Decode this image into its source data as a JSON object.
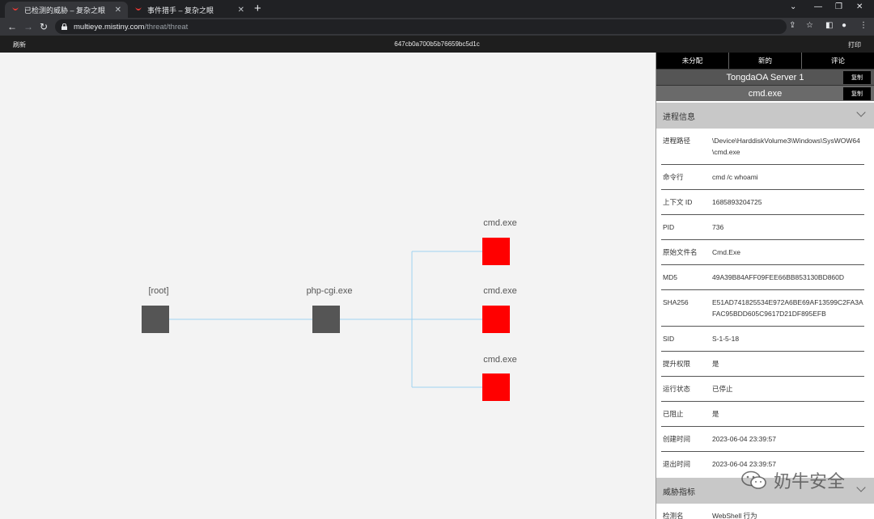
{
  "browser": {
    "tabs": [
      {
        "title": "已检测的威胁 – 复杂之眼",
        "active": true
      },
      {
        "title": "事件猎手 – 复杂之眼",
        "active": false
      }
    ],
    "url_host": "multieye.mistiny.com",
    "url_path": "/threat/threat"
  },
  "header": {
    "refresh": "刷新",
    "threat_id": "647cb0a700b5b76659bc5d1c",
    "print": "打印"
  },
  "graph": {
    "nodes": [
      {
        "label": "[root]",
        "color": "grey"
      },
      {
        "label": "php-cgi.exe",
        "color": "grey"
      },
      {
        "label": "cmd.exe",
        "color": "red"
      },
      {
        "label": "cmd.exe",
        "color": "red"
      },
      {
        "label": "cmd.exe",
        "color": "red"
      }
    ]
  },
  "panel": {
    "tabs": [
      "未分配",
      "新的",
      "评论"
    ],
    "host": "TongdaOA Server 1",
    "process": "cmd.exe",
    "copy_label": "复制",
    "process_section": "进程信息",
    "fields": [
      {
        "k": "进程路径",
        "v": "\\Device\\HarddiskVolume3\\Windows\\SysWOW64\\cmd.exe"
      },
      {
        "k": "命令行",
        "v": "cmd /c whoami"
      },
      {
        "k": "上下文 ID",
        "v": "1685893204725"
      },
      {
        "k": "PID",
        "v": "736"
      },
      {
        "k": "原始文件名",
        "v": "Cmd.Exe"
      },
      {
        "k": "MD5",
        "v": "49A39B84AFF09FEE66BB853130BD860D"
      },
      {
        "k": "SHA256",
        "v": "E51AD741825534E972A6BE69AF13599C2FA3AFAC95BDD605C9617D21DF895EFB"
      },
      {
        "k": "SID",
        "v": "S-1-5-18"
      },
      {
        "k": "提升权限",
        "v": "是"
      },
      {
        "k": "运行状态",
        "v": "已停止"
      },
      {
        "k": "已阻止",
        "v": "是"
      },
      {
        "k": "创建时间",
        "v": "2023-06-04 23:39:57"
      },
      {
        "k": "退出时间",
        "v": "2023-06-04 23:39:57"
      }
    ],
    "indicator_section": "威胁指标",
    "indicators": [
      {
        "k": "检测名",
        "v": "WebShell 行为"
      }
    ]
  },
  "watermark": "奶牛安全",
  "colors": {
    "node_grey": "#555555",
    "node_red": "#ff0000",
    "edge": "#9fd3f0"
  }
}
